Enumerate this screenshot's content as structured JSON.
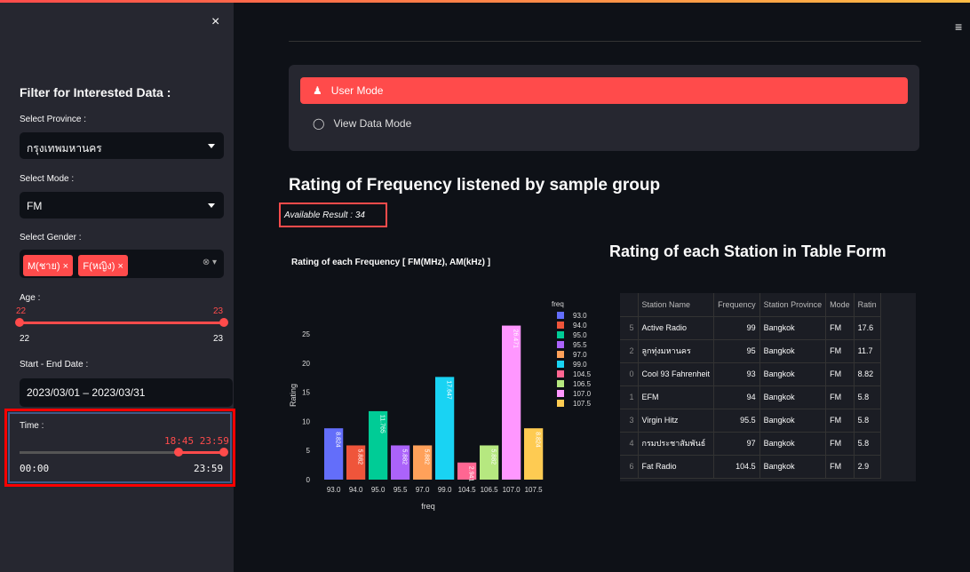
{
  "sidebar": {
    "close_icon": "×",
    "title": "Filter for Interested Data :",
    "province_label": "Select Province :",
    "province_value": "กรุงเทพมหานคร",
    "mode_label": "Select Mode :",
    "mode_value": "FM",
    "gender_label": "Select Gender :",
    "gender_tags": [
      "M(ชาย)",
      "F(หญิง)"
    ],
    "age_label": "Age :",
    "age_low": "22",
    "age_high": "23",
    "age_min": "22",
    "age_max": "23",
    "date_label": "Start - End Date :",
    "date_value": "2023/03/01 – 2023/03/31",
    "time_label": "Time :",
    "time_selected": "18:45  23:59",
    "time_min": "00:00",
    "time_max": "23:59"
  },
  "modes": {
    "user": "User Mode",
    "view": "View Data Mode"
  },
  "main": {
    "heading": "Rating of Frequency listened by sample group",
    "available": "Available Result : 34",
    "table_heading": "Rating of each Station in Table Form"
  },
  "chart_data": {
    "type": "bar",
    "title": "Rating of each Frequency [ FM(MHz), AM(kHz) ]",
    "xlabel": "freq",
    "ylabel": "Rating",
    "ylim": [
      0,
      29
    ],
    "yticks": [
      0,
      5,
      10,
      15,
      20,
      25
    ],
    "legend_title": "freq",
    "categories": [
      "93.0",
      "94.0",
      "95.0",
      "95.5",
      "97.0",
      "99.0",
      "104.5",
      "106.5",
      "107.0",
      "107.5"
    ],
    "values": [
      8.824,
      5.882,
      11.765,
      5.882,
      5.882,
      17.647,
      2.941,
      5.882,
      26.471,
      8.824
    ],
    "labels": [
      "8.824",
      "5.882",
      "11.765",
      "5.882",
      "5.882",
      "17.647",
      "2.941",
      "5.882",
      "26.471",
      "8.824"
    ],
    "colors": [
      "#636efa",
      "#ef553b",
      "#00cc96",
      "#ab63fa",
      "#ffa15a",
      "#19d3f3",
      "#ff6692",
      "#b6e880",
      "#ff97ff",
      "#fecb52"
    ]
  },
  "table": {
    "columns": [
      "",
      "Station Name",
      "Frequency",
      "Station Province",
      "Mode",
      "Ratin"
    ],
    "rows": [
      [
        "5",
        "Active Radio",
        "99",
        "Bangkok",
        "FM",
        "17.6"
      ],
      [
        "2",
        "ลูกทุ่งมหานคร",
        "95",
        "Bangkok",
        "FM",
        "11.7"
      ],
      [
        "0",
        "Cool 93 Fahrenheit",
        "93",
        "Bangkok",
        "FM",
        "8.82"
      ],
      [
        "1",
        "EFM",
        "94",
        "Bangkok",
        "FM",
        "5.8"
      ],
      [
        "3",
        "Virgin Hitz",
        "95.5",
        "Bangkok",
        "FM",
        "5.8"
      ],
      [
        "4",
        "กรมประชาสัมพันธ์",
        "97",
        "Bangkok",
        "FM",
        "5.8"
      ],
      [
        "6",
        "Fat Radio",
        "104.5",
        "Bangkok",
        "FM",
        "2.9"
      ]
    ]
  }
}
